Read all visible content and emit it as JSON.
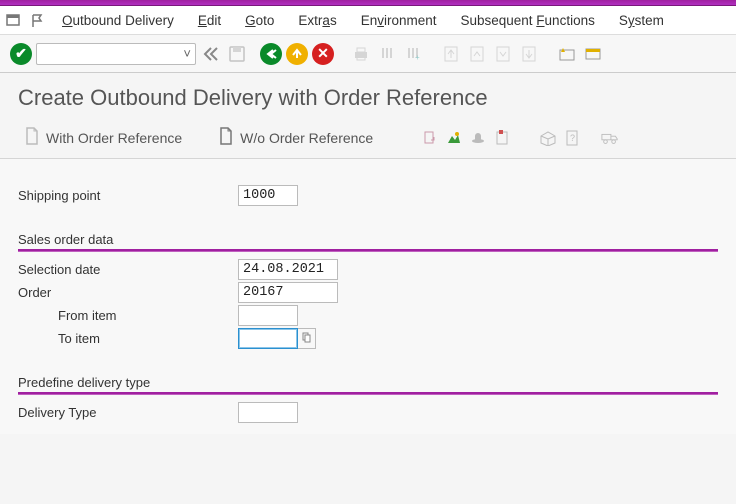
{
  "menu": {
    "outbound_delivery": "Outbound Delivery",
    "edit": "Edit",
    "goto": "Goto",
    "extras": "Extras",
    "environment": "Environment",
    "subsequent_functions": "Subsequent Functions",
    "system": "System"
  },
  "page": {
    "title": "Create Outbound Delivery with Order Reference"
  },
  "subtoolbar": {
    "with_order_ref": "With Order Reference",
    "without_order_ref": "W/o Order Reference"
  },
  "fields": {
    "shipping_point": {
      "label": "Shipping point",
      "value": "1000"
    },
    "selection_date": {
      "label": "Selection date",
      "value": "24.08.2021"
    },
    "order": {
      "label": "Order",
      "value": "20167"
    },
    "from_item": {
      "label": "From item",
      "value": ""
    },
    "to_item": {
      "label": "To item",
      "value": ""
    },
    "delivery_type": {
      "label": "Delivery Type",
      "value": ""
    }
  },
  "groups": {
    "sales_order_data": "Sales order data",
    "predefine_delivery_type": "Predefine delivery type"
  },
  "colors": {
    "accent": "#a020a0"
  }
}
